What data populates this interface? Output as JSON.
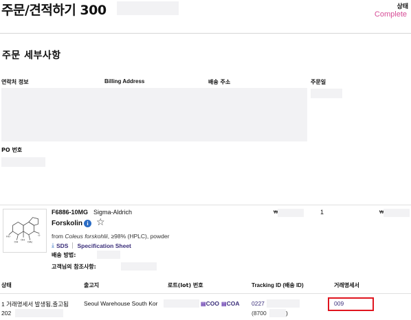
{
  "header": {
    "title": "주문/견적하기 300",
    "status_label": "상태",
    "status_value": "Complete",
    "accent_color": "#d64c96"
  },
  "details": {
    "section_title": "주문 세부사항",
    "columns": [
      "연락처 정보",
      "Billing Address",
      "배송 주소",
      "주문일"
    ],
    "po_label": "PO 번호"
  },
  "item": {
    "sku": "F6886-10MG",
    "brand": "Sigma-Aldrich",
    "price_symbol": "₩",
    "quantity": "1",
    "total_symbol": "₩",
    "name": "Forskolin",
    "info_icon": "info-icon",
    "favorite_icon": "star-outline-icon",
    "desc_prefix": "from ",
    "desc_italic": "Coleus forskohlii",
    "desc_suffix": ", ≥98% (HPLC), powder",
    "sds_label": "SDS",
    "spec_label": "Specification Sheet",
    "shipping_method_label": "배송 방법:",
    "customer_ref_label": "고객님의 참조사항:"
  },
  "shipment_table": {
    "headers": [
      "상태",
      "출고지",
      "로트(lot) 번호",
      "Tracking ID (배송 ID)",
      "거래명세서"
    ],
    "row": {
      "status_line1": "1 거래명세서 발생됨,출고됨",
      "status_line2": "202",
      "warehouse": "Seoul Warehouse South Kor",
      "coo_label": "COO",
      "coa_label": "COA",
      "tracking_line1": "0227",
      "tracking_line2": "(8700",
      "tracking_close": ")",
      "invoice": "009"
    },
    "highlight_color": "#e0141e"
  }
}
